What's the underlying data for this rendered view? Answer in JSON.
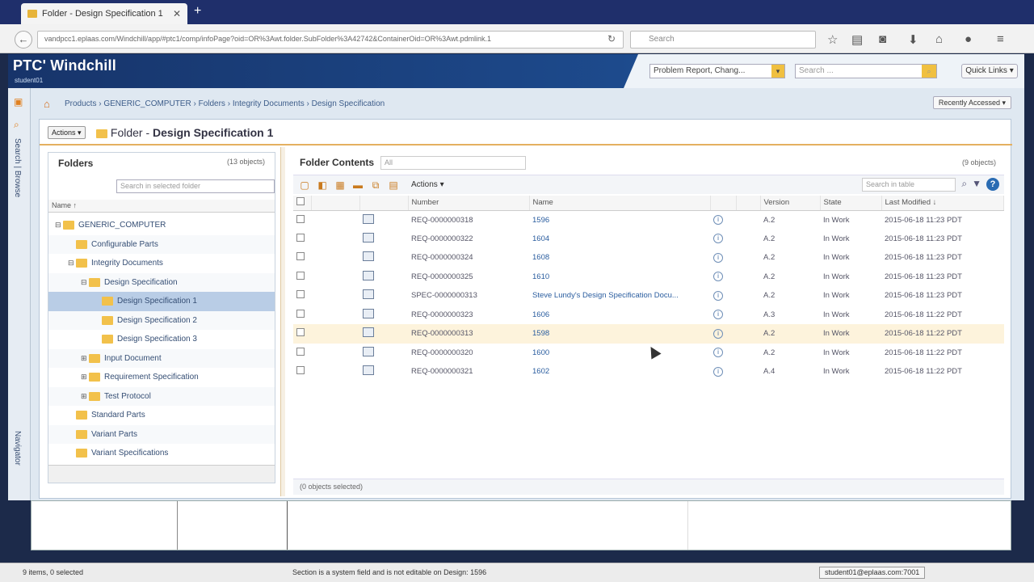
{
  "browser": {
    "tab_title": "Folder - Design Specification 1",
    "url": "vandpcc1.eplaas.com/Windchill/app/#ptc1/comp/infoPage?oid=OR%3Awt.folder.SubFolder%3A42742&ContainerOid=OR%3Awt.pdmlink.1",
    "search_placeholder": "Search"
  },
  "header": {
    "brand": "PTC' Windchill",
    "user": "student01",
    "type_select": "Problem Report, Chang...",
    "search_placeholder": "Search ...",
    "quick_links": "Quick Links"
  },
  "rail": {
    "search_label": "Search | Browse",
    "navigator_label": "Navigator"
  },
  "breadcrumb": "Products › GENERIC_COMPUTER › Folders › Integrity Documents › Design Specification",
  "recently_accessed": "Recently Accessed",
  "page": {
    "actions": "Actions",
    "title_prefix": "Folder - ",
    "title_name": "Design Specification 1"
  },
  "folders": {
    "title": "Folders",
    "count": "(13 objects)",
    "search_placeholder": "Search in selected folder",
    "column": "Name",
    "items": [
      {
        "label": "GENERIC_COMPUTER",
        "indent": 0,
        "exp": "⊟"
      },
      {
        "label": "Configurable Parts",
        "indent": 1,
        "exp": ""
      },
      {
        "label": "Integrity Documents",
        "indent": 1,
        "exp": "⊟"
      },
      {
        "label": "Design Specification",
        "indent": 2,
        "exp": "⊟"
      },
      {
        "label": "Design Specification 1",
        "indent": 3,
        "exp": "",
        "selected": true
      },
      {
        "label": "Design Specification 2",
        "indent": 3,
        "exp": ""
      },
      {
        "label": "Design Specification 3",
        "indent": 3,
        "exp": ""
      },
      {
        "label": "Input Document",
        "indent": 2,
        "exp": "⊞"
      },
      {
        "label": "Requirement Specification",
        "indent": 2,
        "exp": "⊞"
      },
      {
        "label": "Test Protocol",
        "indent": 2,
        "exp": "⊞"
      },
      {
        "label": "Standard Parts",
        "indent": 1,
        "exp": ""
      },
      {
        "label": "Variant Parts",
        "indent": 1,
        "exp": ""
      },
      {
        "label": "Variant Specifications",
        "indent": 1,
        "exp": ""
      }
    ]
  },
  "contents": {
    "title": "Folder Contents",
    "view": "All",
    "count": "(9 objects)",
    "actions": "Actions",
    "search_placeholder": "Search in table",
    "columns": [
      "Number",
      "Name",
      "Version",
      "State",
      "Last Modified"
    ],
    "rows": [
      {
        "number": "REQ-0000000318",
        "name": "1596",
        "version": "A.2",
        "state": "In Work",
        "modified": "2015-06-18 11:23 PDT"
      },
      {
        "number": "REQ-0000000322",
        "name": "1604",
        "version": "A.2",
        "state": "In Work",
        "modified": "2015-06-18 11:23 PDT"
      },
      {
        "number": "REQ-0000000324",
        "name": "1608",
        "version": "A.2",
        "state": "In Work",
        "modified": "2015-06-18 11:23 PDT"
      },
      {
        "number": "REQ-0000000325",
        "name": "1610",
        "version": "A.2",
        "state": "In Work",
        "modified": "2015-06-18 11:23 PDT"
      },
      {
        "number": "SPEC-0000000313",
        "name": "Steve Lundy's Design Specification Docu...",
        "version": "A.2",
        "state": "In Work",
        "modified": "2015-06-18 11:23 PDT"
      },
      {
        "number": "REQ-0000000323",
        "name": "1606",
        "version": "A.3",
        "state": "In Work",
        "modified": "2015-06-18 11:22 PDT"
      },
      {
        "number": "REQ-0000000313",
        "name": "1598",
        "version": "A.2",
        "state": "In Work",
        "modified": "2015-06-18 11:22 PDT",
        "highlight": true
      },
      {
        "number": "REQ-0000000320",
        "name": "1600",
        "version": "A.2",
        "state": "In Work",
        "modified": "2015-06-18 11:22 PDT"
      },
      {
        "number": "REQ-0000000321",
        "name": "1602",
        "version": "A.4",
        "state": "In Work",
        "modified": "2015-06-18 11:22 PDT"
      }
    ],
    "selected": "(0 objects selected)"
  },
  "status": {
    "left": "9 items, 0 selected",
    "mid": "Section is a system field and is not editable on Design: 1596",
    "right": "student01@eplaas.com:7001"
  }
}
